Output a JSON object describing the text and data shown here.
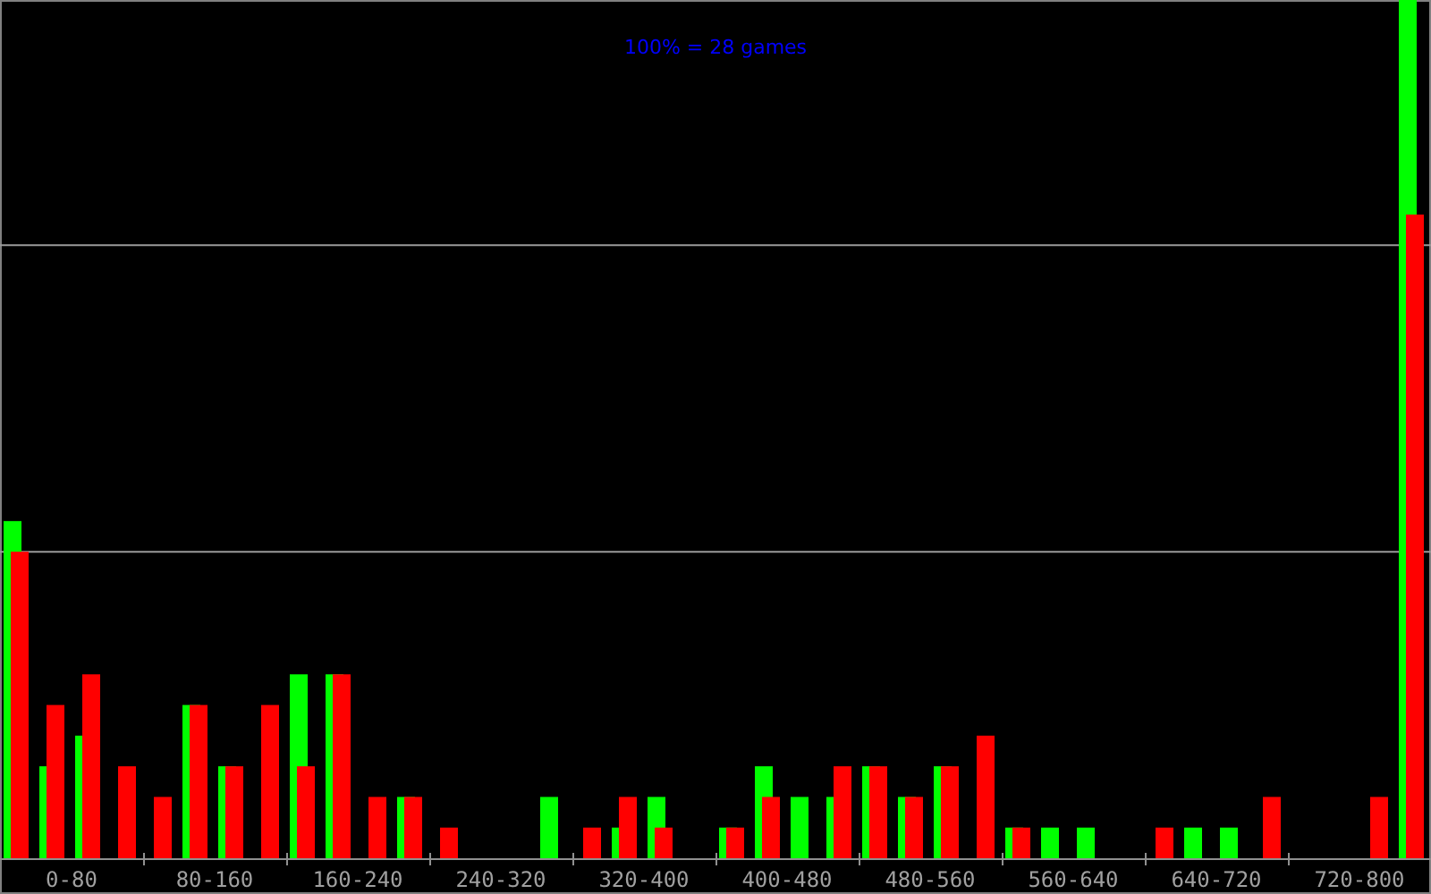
{
  "chart": {
    "title": "100% = 28 games",
    "axis_labels": [
      "0-80",
      "80-160",
      "160-240",
      "240-320",
      "320-400",
      "400-480",
      "480-560",
      "560-640",
      "640-720",
      "720-800"
    ]
  }
}
